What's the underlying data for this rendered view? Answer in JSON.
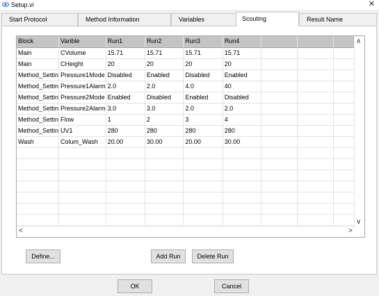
{
  "window": {
    "title": "Setup.vi",
    "close_glyph": "✕"
  },
  "tabs": [
    {
      "label": "Start Protocol",
      "active": false
    },
    {
      "label": "Method Information",
      "active": false
    },
    {
      "label": "Variables",
      "active": false
    },
    {
      "label": "Scouting",
      "active": true
    },
    {
      "label": "Result Name",
      "active": false
    }
  ],
  "grid": {
    "columns": [
      "Block",
      "Varible",
      "Run1",
      "Run2",
      "Run3",
      "Run4",
      "",
      "",
      ""
    ],
    "rows": [
      [
        "Main",
        "CVolume",
        "15.71",
        "15.71",
        "15.71",
        "15.71"
      ],
      [
        "Main",
        "CHeight",
        "20",
        "20",
        "20",
        "20"
      ],
      [
        "Method_Settin",
        "Pressure1Mode",
        "Disabled",
        "Enabled",
        "Disabled",
        "Enabled"
      ],
      [
        "Method_Settin",
        "Pressure1Alarm",
        "2.0",
        "2.0",
        "4.0",
        "40"
      ],
      [
        "Method_Settin",
        "Pressure2Mode",
        "Enabled",
        "Disabled",
        "Enabled",
        "Disabled"
      ],
      [
        "Method_Settin",
        "Pressure2Alarm",
        "3.0",
        "3.0",
        "2.0",
        "2.0"
      ],
      [
        "Method_Settin",
        "Flow",
        "1",
        "2",
        "3",
        "4"
      ],
      [
        "Method_Settin",
        "UV1",
        "280",
        "280",
        "280",
        "280"
      ],
      [
        "Wash",
        "Colum_Wash",
        "20.00",
        "30.00",
        "20.00",
        "30.00"
      ]
    ],
    "empty_rows": 7,
    "scroll_up_glyph": "∧",
    "scroll_down_glyph": "∨",
    "scroll_left_glyph": "<",
    "scroll_right_glyph": ">"
  },
  "buttons": {
    "define": "Define...",
    "add_run": "Add Run",
    "delete_run": "Delete Run",
    "ok": "OK",
    "cancel": "Cancel"
  },
  "icons": {
    "app": "eye-icon"
  },
  "colors": {
    "header_bg": "#c4c4c4",
    "button_bg": "#e1e1e1",
    "tab_active_bg": "#ffffff"
  }
}
